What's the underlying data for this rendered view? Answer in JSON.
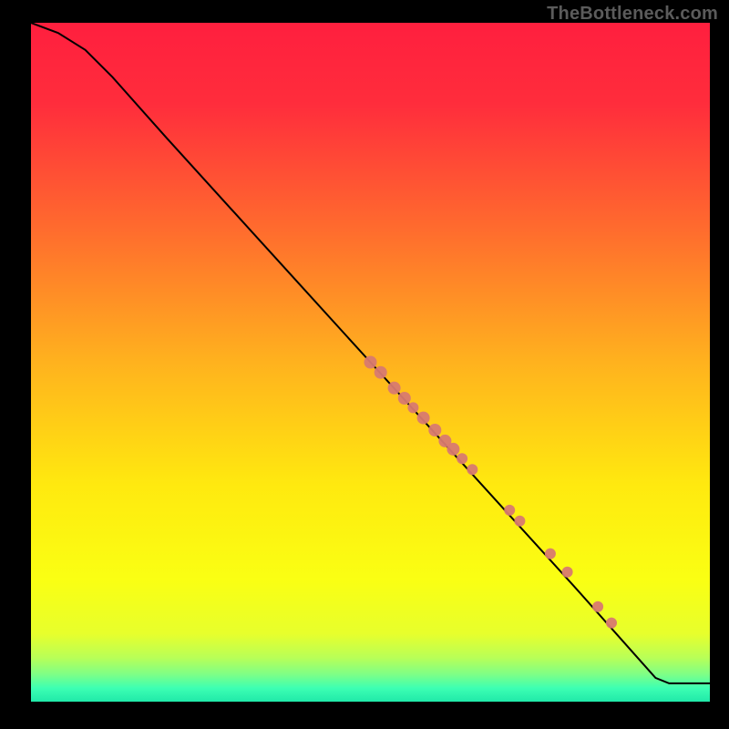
{
  "watermark": "TheBottleneck.com",
  "colors": {
    "point_fill": "#d87a70",
    "line": "#000000"
  },
  "chart_data": {
    "type": "line",
    "title": "",
    "xlabel": "",
    "ylabel": "",
    "xlim": [
      0,
      100
    ],
    "ylim": [
      0,
      100
    ],
    "grid": false,
    "curve": [
      {
        "x": 0,
        "y": 100
      },
      {
        "x": 4,
        "y": 98.5
      },
      {
        "x": 8,
        "y": 96
      },
      {
        "x": 12,
        "y": 92
      },
      {
        "x": 20,
        "y": 83
      },
      {
        "x": 30,
        "y": 72
      },
      {
        "x": 40,
        "y": 61
      },
      {
        "x": 50,
        "y": 50
      },
      {
        "x": 60,
        "y": 39
      },
      {
        "x": 70,
        "y": 28
      },
      {
        "x": 80,
        "y": 17
      },
      {
        "x": 88,
        "y": 8
      },
      {
        "x": 92,
        "y": 3.5
      },
      {
        "x": 94,
        "y": 2.7
      },
      {
        "x": 100,
        "y": 2.7
      }
    ],
    "series": [
      {
        "name": "points",
        "points": [
          {
            "x": 50,
            "y": 50,
            "r": 7
          },
          {
            "x": 51.5,
            "y": 48.5,
            "r": 7
          },
          {
            "x": 53.5,
            "y": 46.2,
            "r": 7
          },
          {
            "x": 55,
            "y": 44.7,
            "r": 7
          },
          {
            "x": 56.3,
            "y": 43.3,
            "r": 6
          },
          {
            "x": 57.8,
            "y": 41.8,
            "r": 7
          },
          {
            "x": 59.5,
            "y": 40.0,
            "r": 7
          },
          {
            "x": 61.0,
            "y": 38.4,
            "r": 7
          },
          {
            "x": 62.2,
            "y": 37.2,
            "r": 7
          },
          {
            "x": 63.5,
            "y": 35.8,
            "r": 6
          },
          {
            "x": 65.0,
            "y": 34.2,
            "r": 6
          },
          {
            "x": 70.5,
            "y": 28.2,
            "r": 6
          },
          {
            "x": 72.0,
            "y": 26.6,
            "r": 6
          },
          {
            "x": 76.5,
            "y": 21.8,
            "r": 6
          },
          {
            "x": 79.0,
            "y": 19.1,
            "r": 6
          },
          {
            "x": 83.5,
            "y": 14.0,
            "r": 6
          },
          {
            "x": 85.5,
            "y": 11.6,
            "r": 6
          }
        ]
      }
    ]
  }
}
